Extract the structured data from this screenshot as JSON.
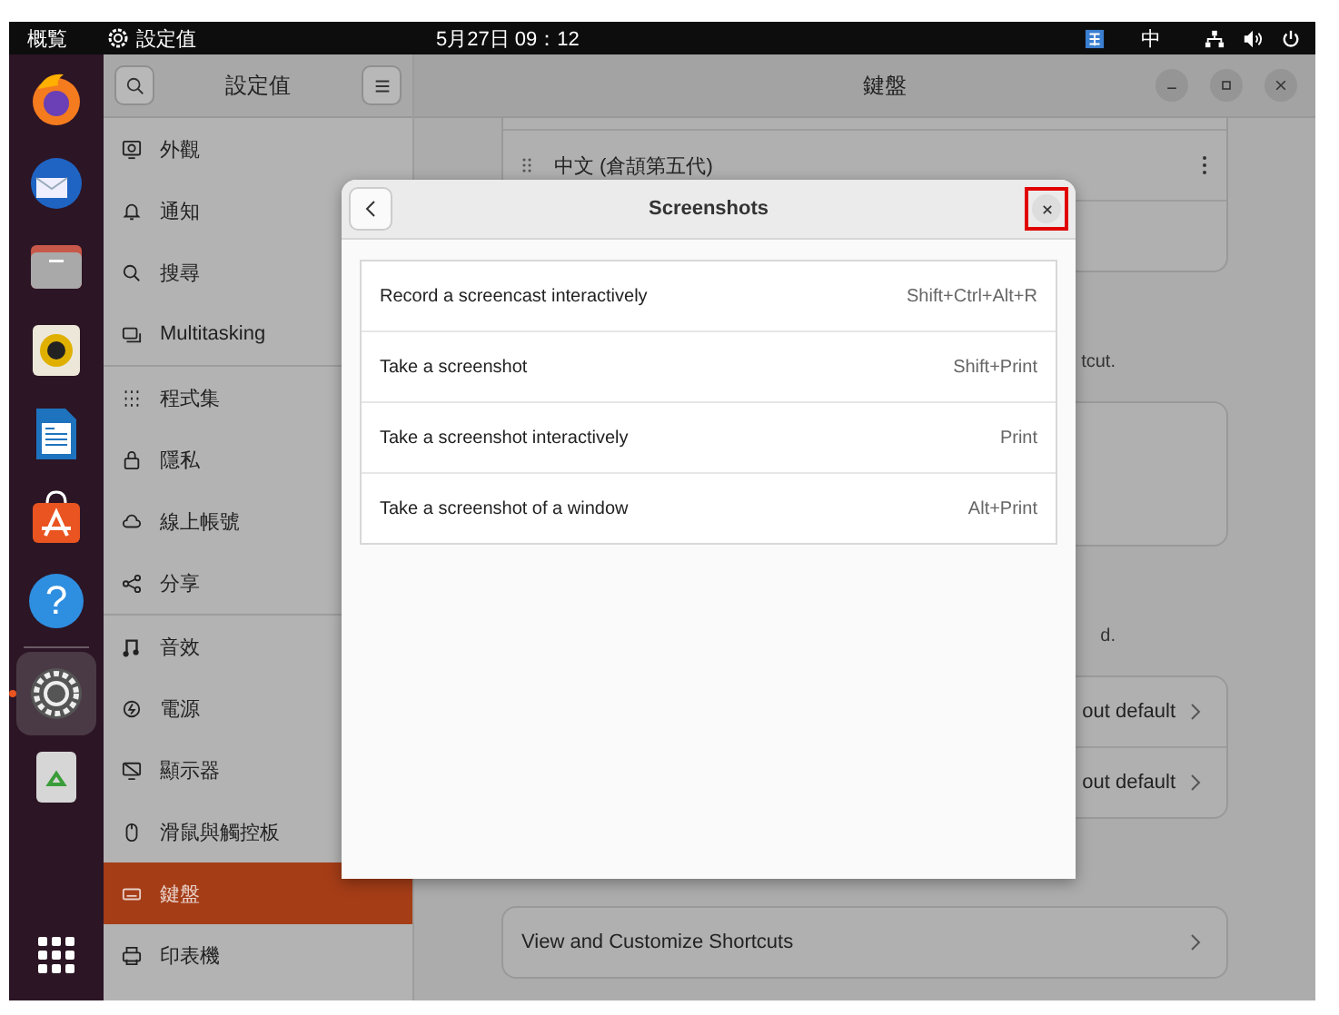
{
  "top_bar": {
    "activities": "概覧",
    "app_name": "設定值",
    "clock": "5月27日  09：12",
    "input_method": "中"
  },
  "dock": {
    "apps": [
      {
        "kind": "browser",
        "running": false
      },
      {
        "kind": "mail",
        "running": false
      },
      {
        "kind": "files",
        "running": false
      },
      {
        "kind": "music",
        "running": false
      },
      {
        "kind": "document",
        "running": false
      },
      {
        "kind": "store",
        "running": false
      },
      {
        "kind": "help",
        "running": false,
        "symbol": "?"
      },
      {
        "kind": "settings",
        "running": true
      },
      {
        "kind": "trash",
        "running": false
      }
    ]
  },
  "sidebar": {
    "title": "設定值",
    "groups": [
      [
        {
          "label": "外觀",
          "selected": false
        },
        {
          "label": "通知",
          "selected": false
        },
        {
          "label": "搜尋",
          "selected": false
        },
        {
          "label": "Multitasking",
          "selected": false
        }
      ],
      [
        {
          "label": "程式集",
          "selected": false
        },
        {
          "label": "隱私",
          "selected": false
        },
        {
          "label": "線上帳號",
          "selected": false
        },
        {
          "label": "分享",
          "selected": false
        }
      ],
      [
        {
          "label": "音效",
          "selected": false
        },
        {
          "label": "電源",
          "selected": false
        },
        {
          "label": "顯示器",
          "selected": false
        },
        {
          "label": "滑鼠與觸控板",
          "selected": false
        },
        {
          "label": "鍵盤",
          "selected": true
        },
        {
          "label": "印表機",
          "selected": false
        }
      ]
    ]
  },
  "main": {
    "title": "鍵盤",
    "input_source": "中文 (倉頡第五代)",
    "note_1": "tcut.",
    "note_2": "d.",
    "rows": [
      "out default",
      "out default"
    ],
    "shortcuts_row": "View and Customize Shortcuts"
  },
  "dialog": {
    "title": "Screenshots",
    "close_highlighted": true,
    "rows": [
      {
        "label": "Record a screencast interactively",
        "shortcut": "Shift+Ctrl+Alt+R"
      },
      {
        "label": "Take a screenshot",
        "shortcut": "Shift+Print"
      },
      {
        "label": "Take a screenshot interactively",
        "shortcut": "Print"
      },
      {
        "label": "Take a screenshot of a window",
        "shortcut": "Alt+Print"
      }
    ]
  }
}
